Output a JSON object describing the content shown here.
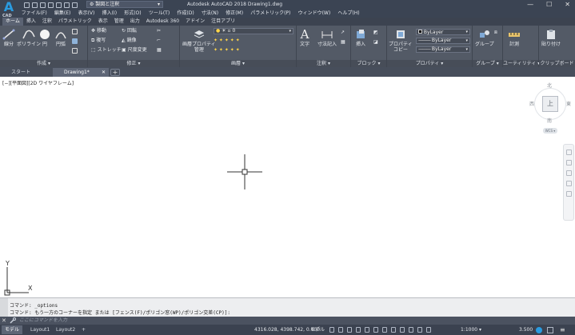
{
  "app": {
    "logo_letter": "A",
    "logo_caption": "CAD",
    "workspace": "製図と注釈",
    "title": "Autodesk AutoCAD 2018    Drawing1.dwg",
    "window_controls": [
      "—",
      "☐",
      "✕"
    ]
  },
  "menu": {
    "items": [
      "ファイル(F)",
      "編集(E)",
      "表示(V)",
      "挿入(I)",
      "形式(O)",
      "ツール(T)",
      "作成(D)",
      "寸法(N)",
      "修正(M)",
      "パラメトリック(P)",
      "ウィンドウ(W)",
      "ヘルプ(H)"
    ]
  },
  "ribbon_tabs": [
    "ホーム",
    "挿入",
    "注釈",
    "パラメトリック",
    "表示",
    "管理",
    "出力",
    "Autodesk 360",
    "アドイン",
    "注目アプリ"
  ],
  "ribbon": {
    "draw": {
      "title": "作成 ▾",
      "line": "線分",
      "polyline": "ポリライン",
      "circle": "円",
      "arc": "円弧"
    },
    "modify": {
      "title": "修正 ▾",
      "move": "移動",
      "copy": "複写",
      "stretch": "ストレッチ",
      "rotate": "回転",
      "mirror": "鏡像",
      "scale": "尺度変更"
    },
    "layers": {
      "title": "画層 ▾",
      "props_line1": "画層プロパティ",
      "props_line2": "管理",
      "current_layer": "0"
    },
    "annotation": {
      "title": "注釈 ▾",
      "text": "文字",
      "dimension": "寸法記入"
    },
    "block": {
      "title": "ブロック ▾",
      "insert": "挿入"
    },
    "properties": {
      "title": "プロパティ ▾",
      "match_line1": "プロパティ",
      "match_line2": "コピー",
      "color": "ByLayer",
      "linetype": "ByLayer",
      "lineweight": "ByLayer"
    },
    "groups": {
      "title": "グループ ▾",
      "group": "グループ"
    },
    "utilities": {
      "title": "ユーティリティ ▾",
      "measure": "計測"
    },
    "clipboard": {
      "title": "クリップボード",
      "paste": "貼り付け"
    }
  },
  "file_tabs": [
    {
      "label": "スタート"
    },
    {
      "label": "Drawing1*"
    }
  ],
  "viewport": {
    "label": "[−][平面図][2D ワイヤフレーム]",
    "viewcube": {
      "north": "北",
      "south": "南",
      "east": "東",
      "west": "西",
      "top_face": "上",
      "wcs": "WCS ▾"
    },
    "ucs": {
      "x": "X",
      "y": "Y"
    }
  },
  "command": {
    "history": [
      "コマンド:  _options",
      "コマンド: もう一方のコーナーを指定 または [フェンス(F)/ポリゴン窓(WP)/ポリゴン交差(CP)]:"
    ],
    "placeholder": "ここにコマンドを入力"
  },
  "status": {
    "layout_tabs": [
      "モデル",
      "Layout1",
      "Layout2",
      "+"
    ],
    "coordinates": "4316.028, 4398.742, 0.000",
    "model": "モデル",
    "scale": "1:1000 ▾",
    "anno_value": "3.500"
  },
  "colors": {
    "titlebar": "#3b4453",
    "ribbon": "#535a66",
    "accent": "#2a9be0"
  }
}
